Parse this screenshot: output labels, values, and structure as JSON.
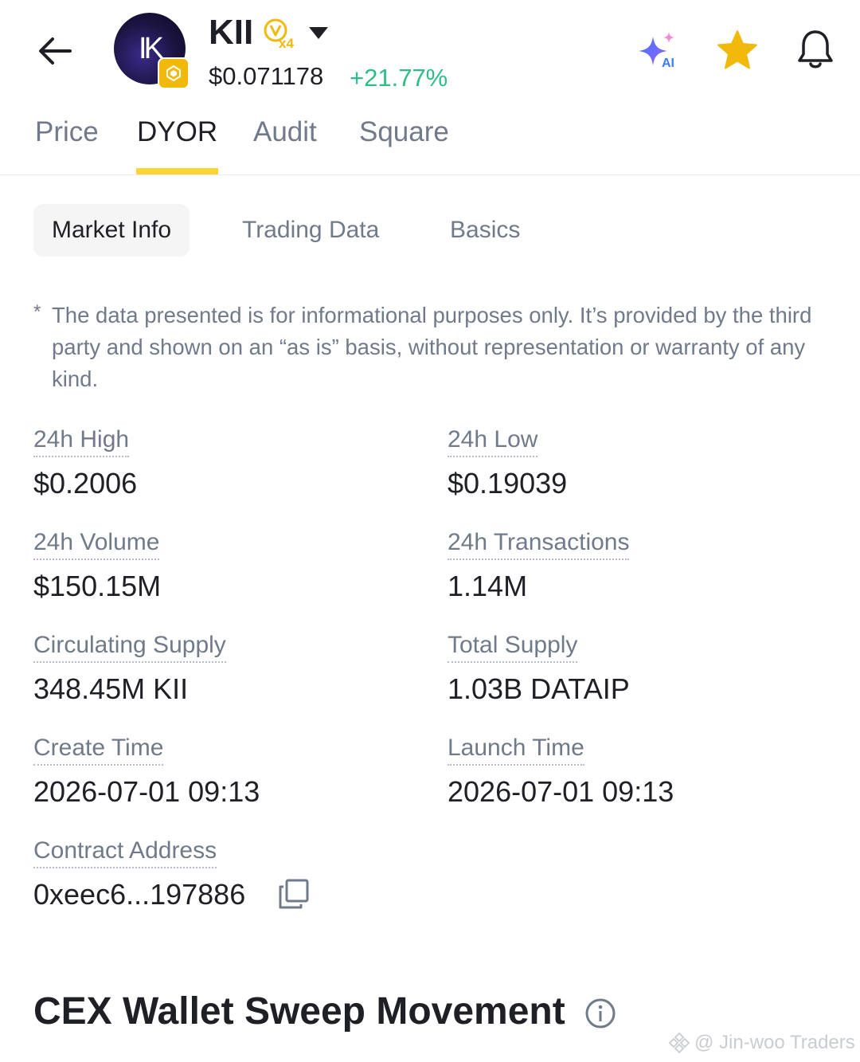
{
  "header": {
    "symbol": "KII",
    "logo_text": "IK",
    "badge_text": "x4",
    "price": "$0.071178",
    "change": "+21.77%",
    "icons": [
      "back-arrow-icon",
      "token-logo",
      "bnb-chain-icon",
      "v-badge-icon",
      "dropdown-caret-icon",
      "ai-sparkle-icon",
      "star-icon",
      "bell-icon"
    ],
    "colors": {
      "positive": "#2ebd85",
      "accent": "#fcd535",
      "favorite": "#f0b90b"
    }
  },
  "tabs": [
    {
      "label": "Price"
    },
    {
      "label": "DYOR"
    },
    {
      "label": "Audit"
    },
    {
      "label": "Square"
    }
  ],
  "active_tab": "DYOR",
  "subtabs": [
    {
      "label": "Market Info"
    },
    {
      "label": "Trading Data"
    },
    {
      "label": "Basics"
    }
  ],
  "active_subtab": "Market Info",
  "disclaimer": {
    "mark": "*",
    "text": "The data presented is for informational purposes only. It’s provided by the third party and shown on an “as is” basis, without representation or warranty of any kind."
  },
  "stats": {
    "high_24h": {
      "label": "24h High",
      "value": "$0.2006"
    },
    "low_24h": {
      "label": "24h Low",
      "value": "$0.19039"
    },
    "volume_24h": {
      "label": "24h Volume",
      "value": "$150.15M"
    },
    "transactions_24h": {
      "label": "24h Transactions",
      "value": "1.14M"
    },
    "circulating_supply": {
      "label": "Circulating Supply",
      "value": "348.45M KII"
    },
    "total_supply": {
      "label": "Total Supply",
      "value": "1.03B DATAIP"
    },
    "create_time": {
      "label": "Create Time",
      "value": "2026-07-01 09:13"
    },
    "launch_time": {
      "label": "Launch Time",
      "value": "2026-07-01 09:13"
    },
    "contract_address": {
      "label": "Contract Address",
      "value": "0xeec6...197886"
    }
  },
  "section": {
    "title": "CEX Wallet Sweep Movement"
  },
  "watermark": "@ Jin-woo Traders"
}
